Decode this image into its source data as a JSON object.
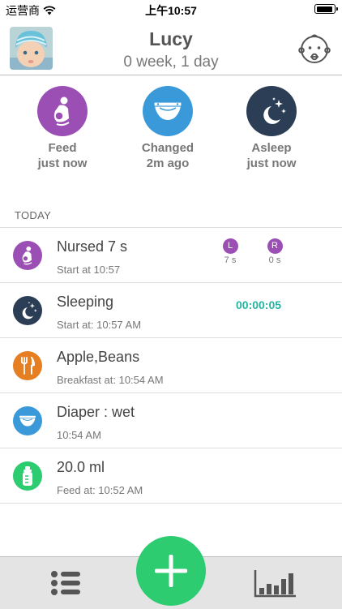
{
  "status_bar": {
    "carrier": "运营商",
    "time": "上午10:57",
    "wifi_icon": "wifi-icon",
    "battery_icon": "battery-icon"
  },
  "header": {
    "baby_name": "Lucy",
    "baby_age": "0 week, 1 day",
    "profile_icon": "baby-face-icon"
  },
  "quick_actions": [
    {
      "label": "Feed",
      "sub": "just now",
      "icon": "nursing-icon",
      "color": "#9b4fb5"
    },
    {
      "label": "Changed",
      "sub": "2m ago",
      "icon": "diaper-icon",
      "color": "#3a9ad9"
    },
    {
      "label": "Asleep",
      "sub": "just now",
      "icon": "moon-stars-icon",
      "color": "#2c3e55"
    }
  ],
  "section": {
    "title": "TODAY"
  },
  "entries": [
    {
      "title": "Nursed 7 s",
      "sub": "Start at 10:57",
      "icon": "nursing-icon",
      "color": "#9b4fb5",
      "left": {
        "label": "L",
        "duration": "7 s"
      },
      "right": {
        "label": "R",
        "duration": "0 s"
      }
    },
    {
      "title": "Sleeping",
      "sub": "Start at: 10:57 AM",
      "icon": "moon-stars-icon",
      "color": "#2c3e55",
      "timer": "00:00:05"
    },
    {
      "title": "Apple,Beans",
      "sub": "Breakfast at: 10:54 AM",
      "icon": "fork-knife-icon",
      "color": "#e67e22"
    },
    {
      "title": "Diaper : wet",
      "sub": "10:54 AM",
      "icon": "diaper-icon",
      "color": "#3a9ad9"
    },
    {
      "title": "20.0 ml",
      "sub": "Feed at: 10:52 AM",
      "icon": "bottle-icon",
      "color": "#2ecc71"
    }
  ],
  "tab_bar": {
    "list_icon": "list-icon",
    "add_icon": "plus-icon",
    "chart_icon": "bar-chart-icon",
    "add_color": "#2ecc71"
  }
}
